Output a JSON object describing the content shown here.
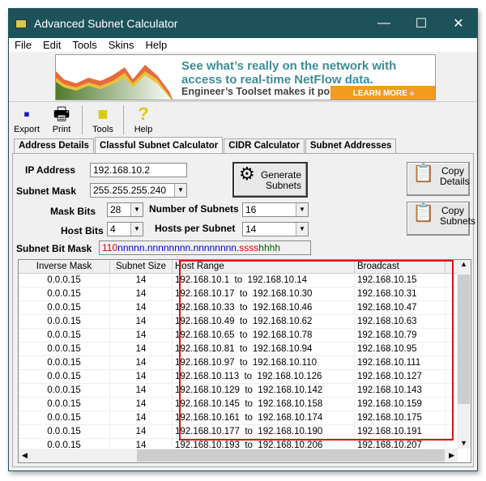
{
  "window": {
    "title": "Advanced Subnet Calculator",
    "minimize": "—",
    "maximize": "☐",
    "close": "✕"
  },
  "menu": [
    "File",
    "Edit",
    "Tools",
    "Skins",
    "Help"
  ],
  "banner": {
    "line1": "See what’s really on the network with access to real-time NetFlow data.",
    "line3": "Engineer’s Toolset makes it possible.",
    "cta": "LEARN MORE »"
  },
  "toolbar": [
    {
      "label": "Export",
      "icon": "floppy-disk-icon"
    },
    {
      "label": "Print",
      "icon": "printer-icon"
    },
    {
      "label": "Tools",
      "icon": "toolbox-icon"
    },
    {
      "label": "Help",
      "icon": "question-mark-icon"
    }
  ],
  "tabs": [
    "Address Details",
    "Classful Subnet Calculator",
    "CIDR Calculator",
    "Subnet Addresses"
  ],
  "active_tab": 1,
  "form": {
    "ip_label": "IP Address",
    "ip_value": "192.168.10.2",
    "mask_label": "Subnet Mask",
    "mask_value": "255.255.255.240",
    "maskbits_label": "Mask Bits",
    "maskbits_value": "28",
    "hostbits_label": "Host Bits",
    "hostbits_value": "4",
    "numsubnets_label": "Number of Subnets",
    "numsubnets_value": "16",
    "hosts_label": "Hosts per Subnet",
    "hosts_value": "14",
    "bitmask_label": "Subnet Bit Mask",
    "bitmask_parts": [
      {
        "text": "110",
        "color": "#e00000"
      },
      {
        "text": "nnnnn.nnnnnnnn.nnnnnnnn.",
        "color": "#0000e0"
      },
      {
        "text": "ssss",
        "color": "#e00000"
      },
      {
        "text": "hhhh",
        "color": "#006000"
      }
    ]
  },
  "buttons": {
    "generate": "Generate Subnets",
    "copy_details": "Copy Details",
    "copy_subnets": "Copy Subnets"
  },
  "table": {
    "columns": [
      "Inverse Mask",
      "Subnet Size",
      "Host Range",
      "Broadcast"
    ],
    "rows": [
      [
        "0.0.0.15",
        "14",
        "192.168.10.1  to  192.168.10.14",
        "192.168.10.15"
      ],
      [
        "0.0.0.15",
        "14",
        "192.168.10.17  to  192.168.10.30",
        "192.168.10.31"
      ],
      [
        "0.0.0.15",
        "14",
        "192.168.10.33  to  192.168.10.46",
        "192.168.10.47"
      ],
      [
        "0.0.0.15",
        "14",
        "192.168.10.49  to  192.168.10.62",
        "192.168.10.63"
      ],
      [
        "0.0.0.15",
        "14",
        "192.168.10.65  to  192.168.10.78",
        "192.168.10.79"
      ],
      [
        "0.0.0.15",
        "14",
        "192.168.10.81  to  192.168.10.94",
        "192.168.10.95"
      ],
      [
        "0.0.0.15",
        "14",
        "192.168.10.97  to  192.168.10.110",
        "192.168.10.111"
      ],
      [
        "0.0.0.15",
        "14",
        "192.168.10.113  to  192.168.10.126",
        "192.168.10.127"
      ],
      [
        "0.0.0.15",
        "14",
        "192.168.10.129  to  192.168.10.142",
        "192.168.10.143"
      ],
      [
        "0.0.0.15",
        "14",
        "192.168.10.145  to  192.168.10.158",
        "192.168.10.159"
      ],
      [
        "0.0.0.15",
        "14",
        "192.168.10.161  to  192.168.10.174",
        "192.168.10.175"
      ],
      [
        "0.0.0.15",
        "14",
        "192.168.10.177  to  192.168.10.190",
        "192.168.10.191"
      ],
      [
        "0.0.0.15",
        "14",
        "192.168.10.193  to  192.168.10.206",
        "192.168.10.207"
      ]
    ]
  },
  "highlight_color": "#e01010"
}
